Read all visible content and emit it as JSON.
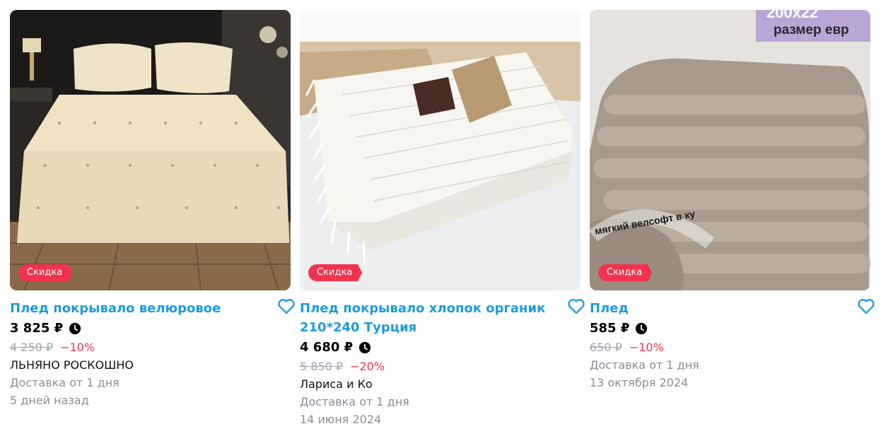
{
  "colors": {
    "accent_title": "#1e9bdb",
    "discount": "#f1334f",
    "badge_bg": "#f1334f",
    "old_price": "#a0a3a8",
    "meta_text": "#8a8e94"
  },
  "products": [
    {
      "image_alt": "bed with quilted cream velour bedspread and two pillows",
      "badge": "Скидка",
      "title": "Плед покрывало велюровое",
      "price": "3 825 ₽",
      "old_price": "4 250 ₽",
      "discount": "−10%",
      "seller": "ЛЬНЯНО РОСКОШНО",
      "delivery": "Доставка от 1 дня",
      "date": "5 дней назад",
      "icons": [
        "heart-outline-icon",
        "clock-icon"
      ]
    },
    {
      "image_alt": "folded white waffle cotton blanket with fringe and kraft tag",
      "badge": "Скидка",
      "title": "Плед покрывало хлопок органик 210*240 Турция",
      "price": "4 680 ₽",
      "old_price": "5 850 ₽",
      "discount": "−20%",
      "seller": "Лариса и Ко",
      "delivery": "Доставка от 1 дня",
      "date": "14 июня 2024",
      "icons": [
        "heart-outline-icon",
        "clock-icon"
      ]
    },
    {
      "image_alt": "folded fluffy beige ribbed velsoft blanket",
      "badge": "Скидка",
      "image_text_top": "размер евр",
      "image_text_top_partial": "200x22",
      "image_text_curved": "мягкий велсофт в ку",
      "title": "Плед",
      "price": "585 ₽",
      "old_price": "650 ₽",
      "discount": "−10%",
      "delivery": "Доставка от 1 дня",
      "date": "13 октября 2024",
      "icons": [
        "heart-outline-icon",
        "clock-icon"
      ]
    }
  ]
}
